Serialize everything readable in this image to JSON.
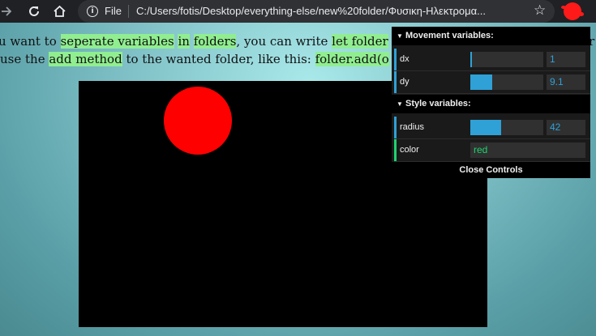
{
  "browser": {
    "file_label": "File",
    "url": "C:/Users/fotis/Desktop/everything-else/new%20folder/Φυσικη-Ηλεκτρομα..."
  },
  "page": {
    "line1": [
      {
        "text": "u want to ",
        "hl": false
      },
      {
        "text": "seperate variables",
        "hl": true
      },
      {
        "text": " ",
        "hl": false
      },
      {
        "text": "in",
        "hl": true
      },
      {
        "text": " ",
        "hl": false
      },
      {
        "text": "folders",
        "hl": true
      },
      {
        "text": ", you can write ",
        "hl": false
      },
      {
        "text": "let folder",
        "hl": true
      },
      {
        "text": " ...",
        "hl": false
      }
    ],
    "line2": [
      {
        "text": " use the ",
        "hl": false
      },
      {
        "text": "add method",
        "hl": true
      },
      {
        "text": " to the wanted folder, like this: ",
        "hl": false
      },
      {
        "text": "folder.add(o",
        "hl": true
      }
    ],
    "line1_tail": "r"
  },
  "canvas": {
    "ball_color": "#ff0000"
  },
  "gui": {
    "folders": [
      {
        "title": "Movement variables:",
        "controls": [
          {
            "name": "dx",
            "value": "1",
            "fill_fraction": 0.02,
            "type": "number"
          },
          {
            "name": "dy",
            "value": "9.1",
            "fill_fraction": 0.3,
            "type": "number"
          }
        ]
      },
      {
        "title": "Style variables:",
        "controls": [
          {
            "name": "radius",
            "value": "42",
            "fill_fraction": 0.42,
            "type": "number"
          },
          {
            "name": "color",
            "value": "red",
            "type": "string"
          }
        ]
      }
    ],
    "close_label": "Close Controls",
    "accent_number": "#2fa1d6",
    "accent_string": "#1ed36f"
  }
}
